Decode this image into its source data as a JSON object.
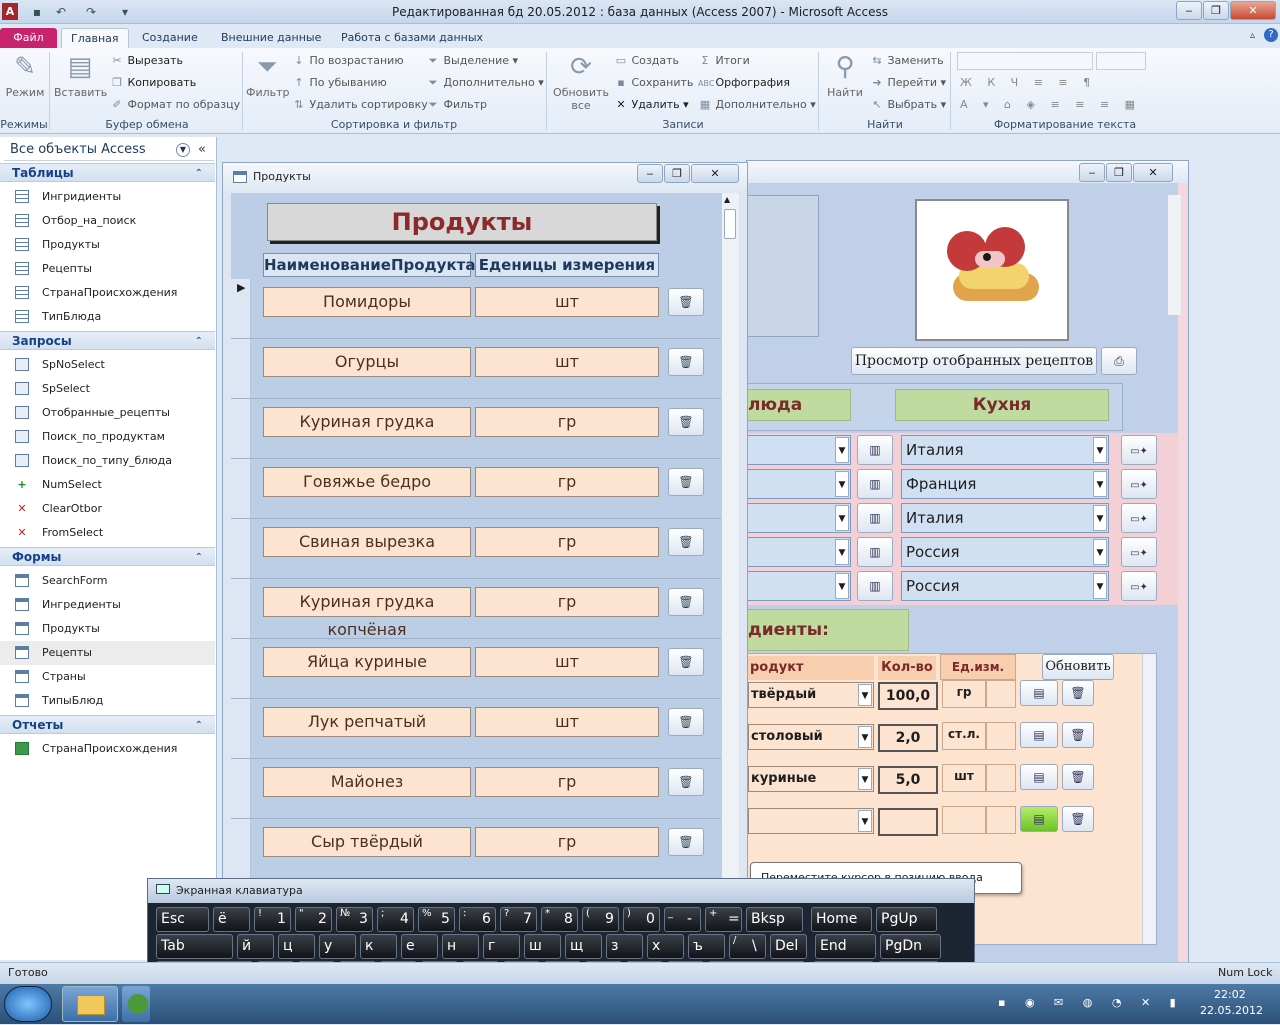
{
  "window": {
    "title": "Редактированная бд 20.05.2012 : база данных (Access 2007)  -  Microsoft Access"
  },
  "ribbon": {
    "tabs": [
      "Файл",
      "Главная",
      "Создание",
      "Внешние данные",
      "Работа с базами данных"
    ],
    "groups": {
      "views": "Режимы",
      "clipboard": "Буфер обмена",
      "sort": "Сортировка и фильтр",
      "records": "Записи",
      "find": "Найти",
      "text": "Форматирование текста"
    },
    "buttons": {
      "mode": "Режим",
      "paste": "Вставить",
      "cut": "Вырезать",
      "copy": "Копировать",
      "format_painter": "Формат по образцу",
      "filter": "Фильтр",
      "asc": "По возрастанию",
      "desc": "По убыванию",
      "remove_sort": "Удалить сортировку",
      "selection": "Выделение",
      "advanced": "Дополнительно",
      "toggle_filter": "Фильтр",
      "refresh": "Обновить все",
      "new": "Создать",
      "save": "Сохранить",
      "delete": "Удалить",
      "totals": "Итоги",
      "spelling": "Орфография",
      "more": "Дополнительно",
      "find": "Найти",
      "replace": "Заменить",
      "goto": "Перейти",
      "select": "Выбрать"
    }
  },
  "nav": {
    "header": "Все объекты Access",
    "sections": [
      {
        "title": "Таблицы",
        "type": "table",
        "items": [
          "Ингридиенты",
          "Отбор_на_поиск",
          "Продукты",
          "Рецепты",
          "СтранаПроисхождения",
          "ТипБлюда"
        ]
      },
      {
        "title": "Запросы",
        "type": "query",
        "items": [
          "SpNoSelect",
          "SpSelect",
          "Отобранные_рецепты",
          "Поиск_по_продуктам",
          "Поиск_по_типу_блюда",
          "NumSelect",
          "ClearOtbor",
          "FromSelect"
        ]
      },
      {
        "title": "Формы",
        "type": "form",
        "items": [
          "SearchForm",
          "Ингредиенты",
          "Продукты",
          "Рецепты",
          "Страны",
          "ТипыБлюд"
        ]
      },
      {
        "title": "Отчеты",
        "type": "report",
        "items": [
          "СтранаПроисхождения"
        ]
      }
    ]
  },
  "products_form": {
    "window_title": "Продукты",
    "heading": "Продукты",
    "col_name": "НаименованиеПродукта",
    "col_unit": "Еденицы измерения",
    "rows": [
      {
        "name": "Помидоры",
        "unit": "шт"
      },
      {
        "name": "Огурцы",
        "unit": "шт"
      },
      {
        "name": "Куриная грудка",
        "unit": "гр"
      },
      {
        "name": "Говяжье бедро",
        "unit": "гр"
      },
      {
        "name": "Свиная вырезка",
        "unit": "гр"
      },
      {
        "name": "Куриная грудка копчёная",
        "unit": "гр"
      },
      {
        "name": "Яйца куриные",
        "unit": "шт"
      },
      {
        "name": "Лук репчатый",
        "unit": "шт"
      },
      {
        "name": "Майонез",
        "unit": "гр"
      },
      {
        "name": "Сыр твёрдый",
        "unit": "гр"
      }
    ]
  },
  "recipes_form": {
    "view_selected_button": "Просмотр отобранных рецептов",
    "dish_type_header": "люда",
    "cuisine_header": "Кухня",
    "cuisines": [
      "Италия",
      "Франция",
      "Италия",
      "Россия",
      "Россия"
    ],
    "ingredients_header": "диенты:",
    "col_product": "родукт",
    "col_qty": "Кол-во",
    "col_unit": "Ед.изм.",
    "refresh_button": "Обновить",
    "ingredients": [
      {
        "product": "твёрдый",
        "qty": "100,0",
        "unit": "гр"
      },
      {
        "product": "столовый",
        "qty": "2,0",
        "unit": "ст.л."
      },
      {
        "product": "куриные",
        "qty": "5,0",
        "unit": "шт"
      }
    ]
  },
  "tooltip": "Переместите курсор в позицию ввода текста.",
  "osk": {
    "title": "Экранная клавиатура"
  },
  "status": {
    "left": "Готово",
    "right": "Num Lock"
  },
  "taskbar": {
    "time": "22:02",
    "date": "22.05.2012"
  }
}
